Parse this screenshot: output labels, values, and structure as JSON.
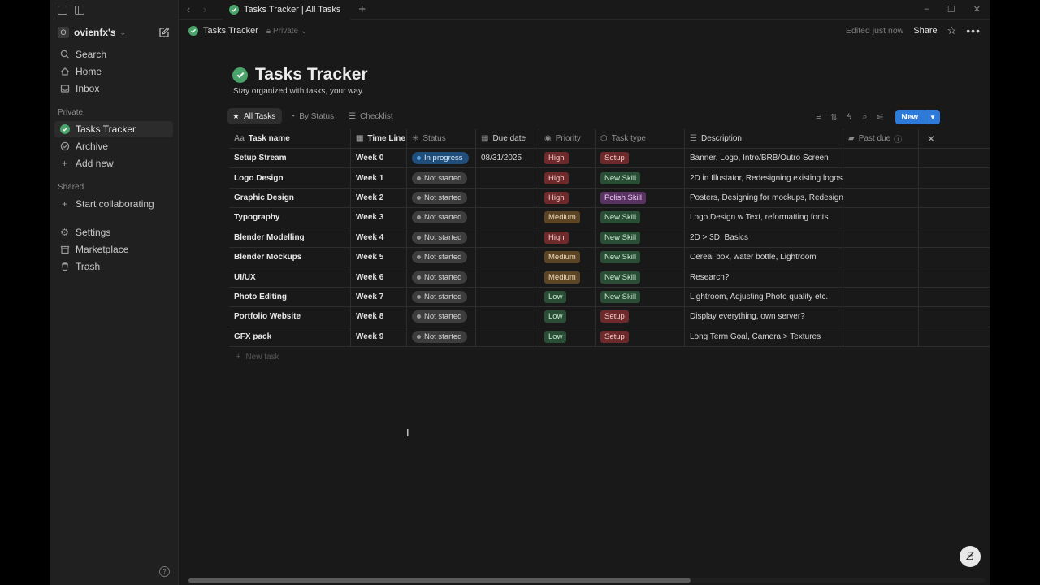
{
  "window": {
    "tab_title": "Tasks Tracker | All Tasks",
    "win_minimize": "–",
    "win_maximize": "☐",
    "win_close": "✕"
  },
  "sidebar": {
    "workspace_initial": "O",
    "workspace_name": "ovienfx's",
    "items_top": [
      {
        "label": "Search",
        "icon": "search-icon"
      },
      {
        "label": "Home",
        "icon": "home-icon"
      },
      {
        "label": "Inbox",
        "icon": "inbox-icon"
      }
    ],
    "section_private": "Private",
    "private_items": [
      {
        "label": "Tasks Tracker",
        "icon": "check-circle-icon",
        "active": true
      },
      {
        "label": "Archive",
        "icon": "archive-icon"
      },
      {
        "label": "Add new",
        "icon": "plus-icon"
      }
    ],
    "section_shared": "Shared",
    "shared_items": [
      {
        "label": "Start collaborating",
        "icon": "plus-icon"
      }
    ],
    "bottom_items": [
      {
        "label": "Settings",
        "icon": "gear-icon"
      },
      {
        "label": "Marketplace",
        "icon": "marketplace-icon"
      },
      {
        "label": "Trash",
        "icon": "trash-icon"
      }
    ]
  },
  "pagebar": {
    "breadcrumb": "Tasks Tracker",
    "privacy": "Private",
    "edited": "Edited just now",
    "share": "Share"
  },
  "page": {
    "title": "Tasks Tracker",
    "subtitle": "Stay organized with tasks, your way."
  },
  "views": [
    {
      "label": "All Tasks",
      "active": true
    },
    {
      "label": "By Status",
      "active": false
    },
    {
      "label": "Checklist",
      "active": false
    }
  ],
  "toolbar": {
    "new_label": "New"
  },
  "table": {
    "headers": {
      "name": "Task name",
      "timeline": "Time Line",
      "status": "Status",
      "due": "Due date",
      "priority": "Priority",
      "type": "Task type",
      "description": "Description",
      "past_due": "Past due"
    },
    "rows": [
      {
        "name": "Setup Stream",
        "timeline": "Week 0",
        "status": "In progress",
        "due": "08/31/2025",
        "priority": "High",
        "type": "Setup",
        "description": "Banner, Logo, Intro/BRB/Outro Screen"
      },
      {
        "name": "Logo Design",
        "timeline": "Week 1",
        "status": "Not started",
        "due": "",
        "priority": "High",
        "type": "New Skill",
        "description": "2D in Illustator, Redesigning existing logos"
      },
      {
        "name": "Graphic Design",
        "timeline": "Week 2",
        "status": "Not started",
        "due": "",
        "priority": "High",
        "type": "Polish Skill",
        "description": "Posters, Designing for mockups, Redesigning"
      },
      {
        "name": "Typography",
        "timeline": "Week 3",
        "status": "Not started",
        "due": "",
        "priority": "Medium",
        "type": "New Skill",
        "description": "Logo Design w Text, reformatting fonts"
      },
      {
        "name": "Blender Modelling",
        "timeline": "Week 4",
        "status": "Not started",
        "due": "",
        "priority": "High",
        "type": "New Skill",
        "description": "2D > 3D, Basics"
      },
      {
        "name": "Blender Mockups",
        "timeline": "Week 5",
        "status": "Not started",
        "due": "",
        "priority": "Medium",
        "type": "New Skill",
        "description": "Cereal box, water bottle, Lightroom"
      },
      {
        "name": "UI/UX",
        "timeline": "Week 6",
        "status": "Not started",
        "due": "",
        "priority": "Medium",
        "type": "New Skill",
        "description": "Research?"
      },
      {
        "name": "Photo Editing",
        "timeline": "Week 7",
        "status": "Not started",
        "due": "",
        "priority": "Low",
        "type": "New Skill",
        "description": "Lightroom, Adjusting Photo quality etc."
      },
      {
        "name": "Portfolio Website",
        "timeline": "Week 8",
        "status": "Not started",
        "due": "",
        "priority": "Low",
        "type": "Setup",
        "description": "Display everything, own server?"
      },
      {
        "name": "GFX pack",
        "timeline": "Week 9",
        "status": "Not started",
        "due": "",
        "priority": "Low",
        "type": "Setup",
        "description": "Long Term Goal, Camera > Textures"
      }
    ],
    "new_task": "New task"
  },
  "colors": {
    "accent": "#2e7ad8",
    "check_green": "#4aa36a"
  }
}
